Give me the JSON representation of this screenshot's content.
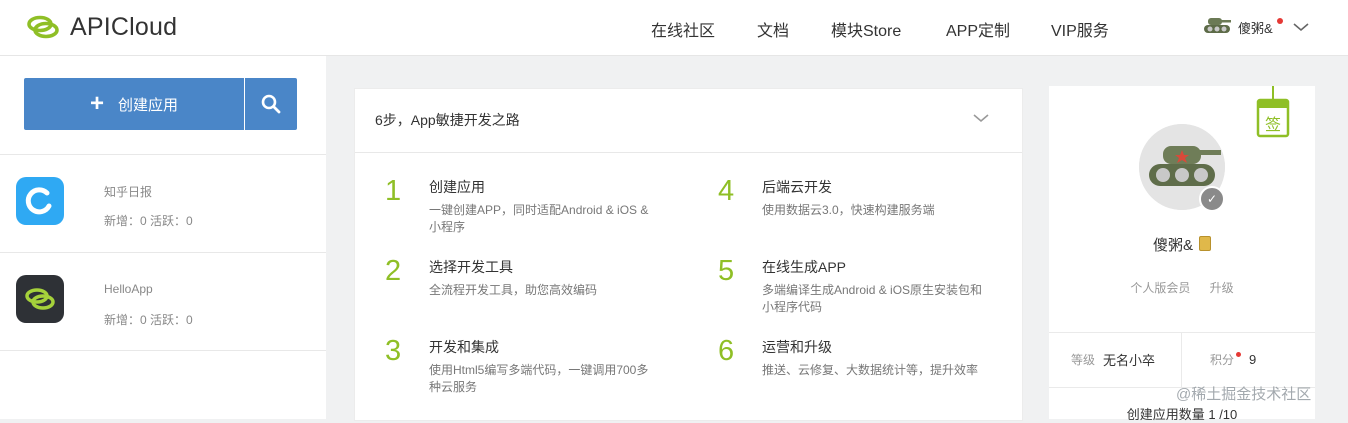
{
  "header": {
    "logo_text": "APICloud",
    "nav": [
      {
        "label": "在线社区"
      },
      {
        "label": "文档"
      },
      {
        "label": "模块Store"
      },
      {
        "label": "APP定制"
      },
      {
        "label": "VIP服务"
      }
    ],
    "user_name": "傻粥&"
  },
  "sidebar": {
    "create_label": "创建应用",
    "apps": [
      {
        "name": "知乎日报",
        "stats": "新增：0   活跃：0"
      },
      {
        "name": "HelloApp",
        "stats": "新增：0   活跃：0"
      }
    ]
  },
  "steps": {
    "title": "6步，App敏捷开发之路",
    "items": [
      {
        "num": "1",
        "title": "创建应用",
        "desc": "一键创建APP，同时适配Android & iOS & 小程序"
      },
      {
        "num": "2",
        "title": "选择开发工具",
        "desc": "全流程开发工具，助您高效编码"
      },
      {
        "num": "3",
        "title": "开发和集成",
        "desc": "使用Html5编写多端代码，一键调用700多种云服务"
      },
      {
        "num": "4",
        "title": "后端云开发",
        "desc": "使用数据云3.0，快速构建服务端"
      },
      {
        "num": "5",
        "title": "在线生成APP",
        "desc": "多端编译生成Android & iOS原生安装包和小程序代码"
      },
      {
        "num": "6",
        "title": "运营和升级",
        "desc": "推送、云修复、大数据统计等，提升效率"
      }
    ]
  },
  "profile": {
    "name": "傻粥&",
    "membership": "个人版会员",
    "upgrade": "升级",
    "sign_label": "签",
    "level_label": "等级",
    "level_value": "无名小卒",
    "points_label": "积分",
    "points_value": "9",
    "apps_count": "创建应用数量 1 /10"
  },
  "watermark": "@稀土掘金技术社区",
  "colors": {
    "accent": "#4a86c8",
    "step_number": "#8fbf26",
    "logo_green": "#8fbf26"
  }
}
